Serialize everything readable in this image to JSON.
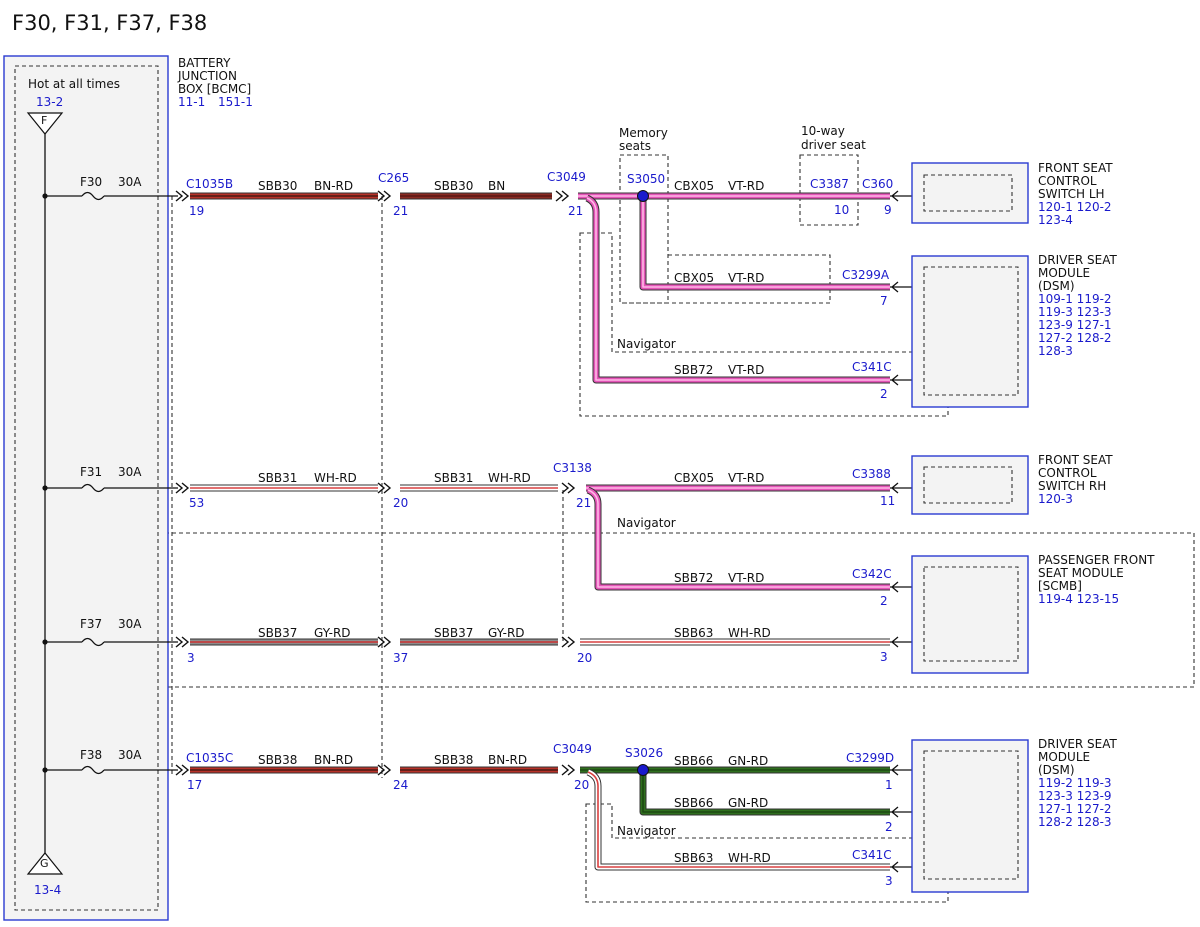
{
  "title": "F30, F31, F37, F38",
  "colors": {
    "BN-RD": {
      "base": "#b83228",
      "stripe": "#4a1a14"
    },
    "BN": {
      "base": "#8b2a22",
      "stripe": "#5a1814"
    },
    "WH-RD": {
      "base": "#ffffff",
      "stripe": "#d94040"
    },
    "GY-RD": {
      "base": "#8c8c8c",
      "stripe": "#cc3333"
    },
    "VT-RD": {
      "base": "#e455b8",
      "stripe": "#ffb8e6"
    },
    "GN-RD": {
      "base": "#2f6f1e",
      "stripe": "#1d4a12"
    },
    "label_blue": "#1a1acc",
    "box_blue": "#2a3bd1"
  },
  "bjb": {
    "hot_label": "Hot at all times",
    "name_lines": [
      "BATTERY",
      "JUNCTION",
      "BOX [BCMC]"
    ],
    "refs": [
      "11-1",
      "151-1"
    ],
    "top_ref": "13-2",
    "bottom_ref": "13-4",
    "top_symbol": "F",
    "bottom_symbol": "G"
  },
  "fuses": [
    {
      "name": "F30",
      "amps": "30A"
    },
    {
      "name": "F31",
      "amps": "30A"
    },
    {
      "name": "F37",
      "amps": "30A"
    },
    {
      "name": "F38",
      "amps": "30A"
    }
  ],
  "labels": {
    "c1035b": "C1035B",
    "c1035c": "C1035C",
    "c265": "C265",
    "c3049": "C3049",
    "c3049b": "C3049",
    "c3138": "C3138",
    "s3050": "S3050",
    "s3026": "S3026",
    "c3387": "C3387",
    "c360": "C360",
    "c3299a": "C3299A",
    "c341c_a": "C341C",
    "c3388": "C3388",
    "c342c": "C342C",
    "c3299d": "C3299D",
    "c341c_b": "C341C",
    "memory_seats": [
      "Memory",
      "seats"
    ],
    "ten_way": [
      "10-way",
      "driver seat"
    ],
    "navigator": "Navigator"
  },
  "pins": {
    "p19": "19",
    "p21a": "21",
    "p21b": "21",
    "p10": "10",
    "p9": "9",
    "p7": "7",
    "p2a": "2",
    "p53": "53",
    "p20a": "20",
    "p21c": "21",
    "p11": "11",
    "p2b": "2",
    "p3a": "3",
    "p37": "37",
    "p20b": "20",
    "p3b": "3",
    "p17": "17",
    "p24": "24",
    "p20c": "20",
    "p1": "1",
    "p2c": "2",
    "p3c": "3"
  },
  "wires": {
    "w1": {
      "circuit": "SBB30",
      "color": "BN-RD"
    },
    "w2": {
      "circuit": "SBB30",
      "color": "BN"
    },
    "w3": {
      "circuit": "CBX05",
      "color": "VT-RD"
    },
    "w4": {
      "circuit": "CBX05",
      "color": "VT-RD"
    },
    "w5": {
      "circuit": "SBB72",
      "color": "VT-RD"
    },
    "w6": {
      "circuit": "SBB31",
      "color": "WH-RD"
    },
    "w7": {
      "circuit": "SBB31",
      "color": "WH-RD"
    },
    "w8": {
      "circuit": "CBX05",
      "color": "VT-RD"
    },
    "w9": {
      "circuit": "SBB72",
      "color": "VT-RD"
    },
    "w10": {
      "circuit": "SBB37",
      "color": "GY-RD"
    },
    "w11": {
      "circuit": "SBB37",
      "color": "GY-RD"
    },
    "w12": {
      "circuit": "SBB63",
      "color": "WH-RD"
    },
    "w13": {
      "circuit": "SBB38",
      "color": "BN-RD"
    },
    "w14": {
      "circuit": "SBB38",
      "color": "BN-RD"
    },
    "w15": {
      "circuit": "SBB66",
      "color": "GN-RD"
    },
    "w16": {
      "circuit": "SBB66",
      "color": "GN-RD"
    },
    "w17": {
      "circuit": "SBB63",
      "color": "WH-RD"
    }
  },
  "components": {
    "fscs_lh": {
      "name_lines": [
        "FRONT SEAT",
        "CONTROL",
        "SWITCH LH"
      ],
      "refs": [
        "120-1  120-2",
        "123-4"
      ]
    },
    "dsm_a": {
      "name_lines": [
        "DRIVER SEAT",
        "MODULE",
        "(DSM)"
      ],
      "refs": [
        "109-1  119-2",
        "119-3  123-3",
        "123-9  127-1",
        "127-2  128-2",
        "128-3"
      ]
    },
    "fscs_rh": {
      "name_lines": [
        "FRONT SEAT",
        "CONTROL",
        "SWITCH RH"
      ],
      "refs": [
        "120-3"
      ]
    },
    "pfsm": {
      "name_lines": [
        "PASSENGER FRONT",
        "SEAT MODULE",
        "[SCMB]"
      ],
      "refs": [
        "119-4   123-15"
      ]
    },
    "dsm_b": {
      "name_lines": [
        "DRIVER SEAT",
        "MODULE",
        "(DSM)"
      ],
      "refs": [
        "119-2  119-3",
        "123-3  123-9",
        "127-1  127-2",
        "128-2  128-3"
      ]
    }
  }
}
